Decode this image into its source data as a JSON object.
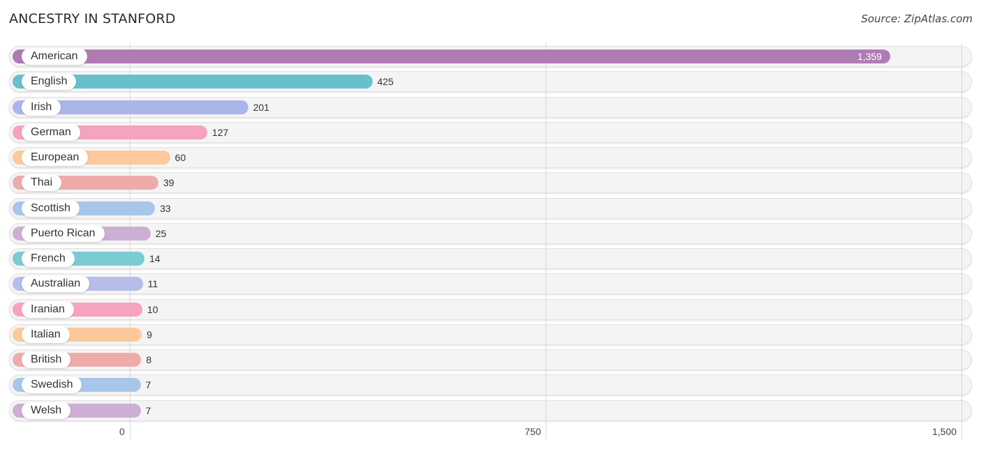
{
  "header": {
    "title": "ANCESTRY IN STANFORD",
    "source": "Source: ZipAtlas.com"
  },
  "chart_data": {
    "type": "bar",
    "orientation": "horizontal",
    "title": "ANCESTRY IN STANFORD",
    "xlabel": "",
    "ylabel": "",
    "xlim": [
      0,
      1500
    ],
    "grid": true,
    "x_ticks": [
      {
        "value": 0,
        "label": "0"
      },
      {
        "value": 750,
        "label": "750"
      },
      {
        "value": 1500,
        "label": "1,500"
      }
    ],
    "categories": [
      "American",
      "English",
      "Irish",
      "German",
      "European",
      "Thai",
      "Scottish",
      "Puerto Rican",
      "French",
      "Australian",
      "Iranian",
      "Italian",
      "British",
      "Swedish",
      "Welsh"
    ],
    "values": [
      1359,
      425,
      201,
      127,
      60,
      39,
      33,
      25,
      14,
      11,
      10,
      9,
      8,
      7,
      7
    ],
    "value_labels": [
      "1,359",
      "425",
      "201",
      "127",
      "60",
      "39",
      "33",
      "25",
      "14",
      "11",
      "10",
      "9",
      "8",
      "7",
      "7"
    ],
    "colors": [
      "#ae7bb3",
      "#67c1cc",
      "#aab5e8",
      "#f5a3bf",
      "#fbc99b",
      "#efabab",
      "#a7c6ea",
      "#ccafd3",
      "#7acbd4",
      "#b5bdeb",
      "#f5a3bf",
      "#fbc99b",
      "#efabab",
      "#a7c6ea",
      "#ccafd3"
    ]
  }
}
